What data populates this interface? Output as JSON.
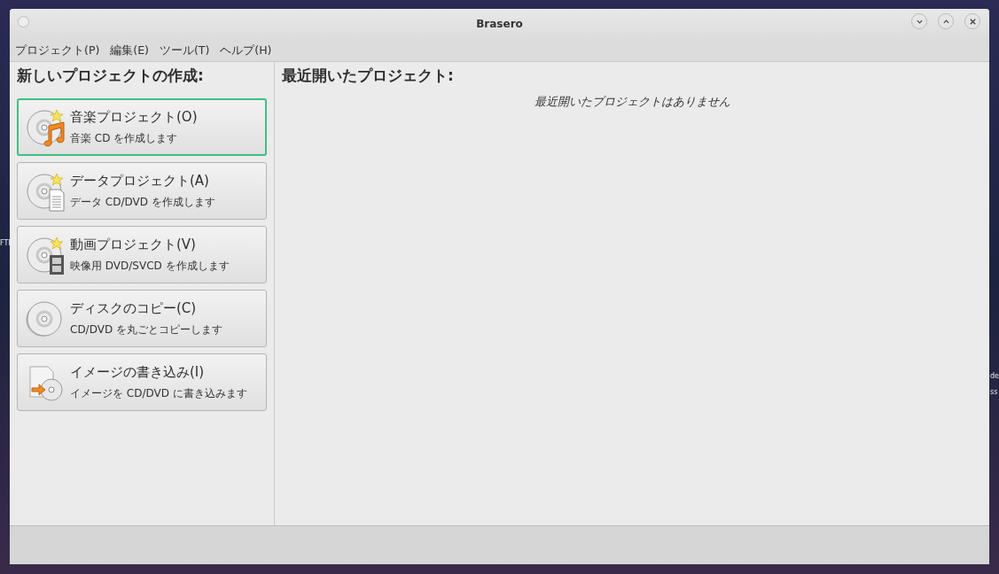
{
  "desktop": {
    "labels": [
      {
        "text": "FTI"
      },
      {
        "text": "de"
      },
      {
        "text": "ss"
      }
    ]
  },
  "window": {
    "title": "Brasero"
  },
  "menu": [
    "プロジェクト(P)",
    "編集(E)",
    "ツール(T)",
    "ヘルプ(H)"
  ],
  "new_project": {
    "heading": "新しいプロジェクトの作成:",
    "items": [
      {
        "kind": "audio",
        "title": "音楽プロジェクト(O)",
        "description": "音楽 CD を作成します",
        "selected": true
      },
      {
        "kind": "data",
        "title": "データプロジェクト(A)",
        "description": "データ CD/DVD を作成します",
        "selected": false
      },
      {
        "kind": "video",
        "title": "動画プロジェクト(V)",
        "description": "映像用 DVD/SVCD を作成します",
        "selected": false
      },
      {
        "kind": "copy",
        "title": "ディスクのコピー(C)",
        "description": "CD/DVD を丸ごとコピーします",
        "selected": false
      },
      {
        "kind": "image",
        "title": "イメージの書き込み(I)",
        "description": "イメージを CD/DVD に書き込みます",
        "selected": false
      }
    ]
  },
  "recent": {
    "heading": "最近開いたプロジェクト:",
    "empty_message": "最近開いたプロジェクトはありません"
  }
}
